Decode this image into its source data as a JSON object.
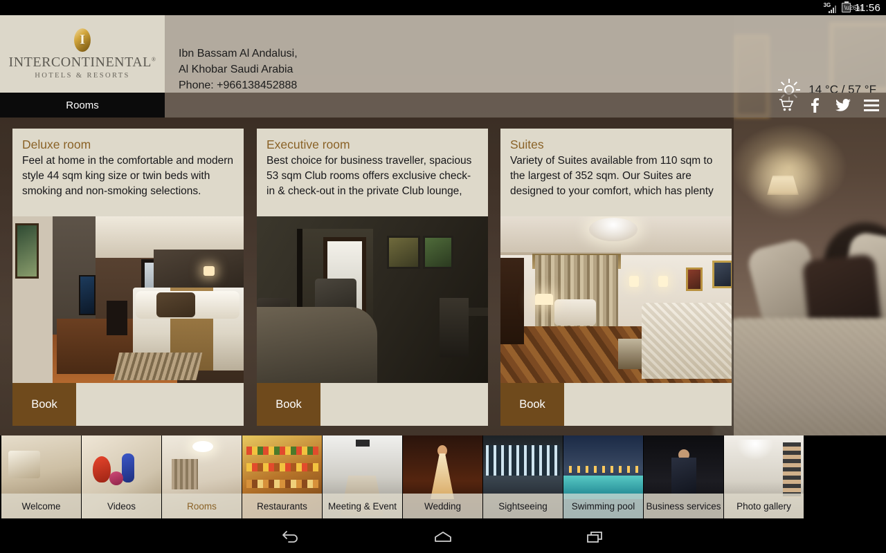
{
  "statusbar": {
    "network_label": "3G",
    "time": "11:56",
    "signal_icon": "signal-bars-icon",
    "battery_icon": "battery-charging-icon"
  },
  "header": {
    "logo": {
      "name": "INTERCONTINENTAL",
      "registered": "®",
      "subtitle": "HOTELS & RESORTS",
      "emblem_letter": "I"
    },
    "address_line1": "Ibn Bassam Al Andalusi,",
    "address_line2": "Al Khobar Saudi Arabia",
    "address_line3": "Phone: +966138452888",
    "weather": {
      "icon": "sun-icon",
      "text": "14 °C / 57 °F"
    }
  },
  "navbar": {
    "active_tab": "Rooms",
    "icons": [
      {
        "name": "cart-icon"
      },
      {
        "name": "facebook-icon"
      },
      {
        "name": "twitter-icon"
      },
      {
        "name": "hamburger-menu-icon"
      }
    ]
  },
  "cards": [
    {
      "title": "Deluxe room",
      "description": "Feel at home in the comfortable and modern style 44 sqm king size or twin beds with smoking and non-smoking selections.",
      "photo": "deluxe-room-photo",
      "book_label": "Book"
    },
    {
      "title": "Executive room",
      "description": "Best choice for business traveller, spacious 53 sqm Club rooms offers exclusive check-in & check-out in the private Club lounge,",
      "photo": "executive-room-photo",
      "book_label": "Book"
    },
    {
      "title": "Suites",
      "description": "Variety of Suites available from 110 sqm to the largest of 352 sqm. Our Suites are designed to your comfort, which has plenty",
      "photo": "suites-photo",
      "book_label": "Book"
    }
  ],
  "thumbnails": [
    {
      "label": "Welcome",
      "active": false,
      "tinted": false
    },
    {
      "label": "Videos",
      "active": false,
      "tinted": false
    },
    {
      "label": "Rooms",
      "active": true,
      "tinted": false
    },
    {
      "label": "Restaurants",
      "active": false,
      "tinted": false
    },
    {
      "label": "Meeting & Event",
      "active": false,
      "tinted": false
    },
    {
      "label": "Wedding",
      "active": false,
      "tinted": false
    },
    {
      "label": "Sightseeing",
      "active": false,
      "tinted": false
    },
    {
      "label": "Swimming pool",
      "active": false,
      "tinted": true
    },
    {
      "label": "Business services",
      "active": false,
      "tinted": false
    },
    {
      "label": "Photo gallery",
      "active": false,
      "tinted": false
    }
  ],
  "android_nav": [
    {
      "name": "back-button"
    },
    {
      "name": "home-button"
    },
    {
      "name": "recents-button"
    }
  ],
  "colors": {
    "accent_brown": "#8a6227",
    "book_button": "#6f4a1c",
    "card_bg": "#ded9ca",
    "logo_bg": "#dcd7c9",
    "header_bg": "#c4bcaf"
  }
}
